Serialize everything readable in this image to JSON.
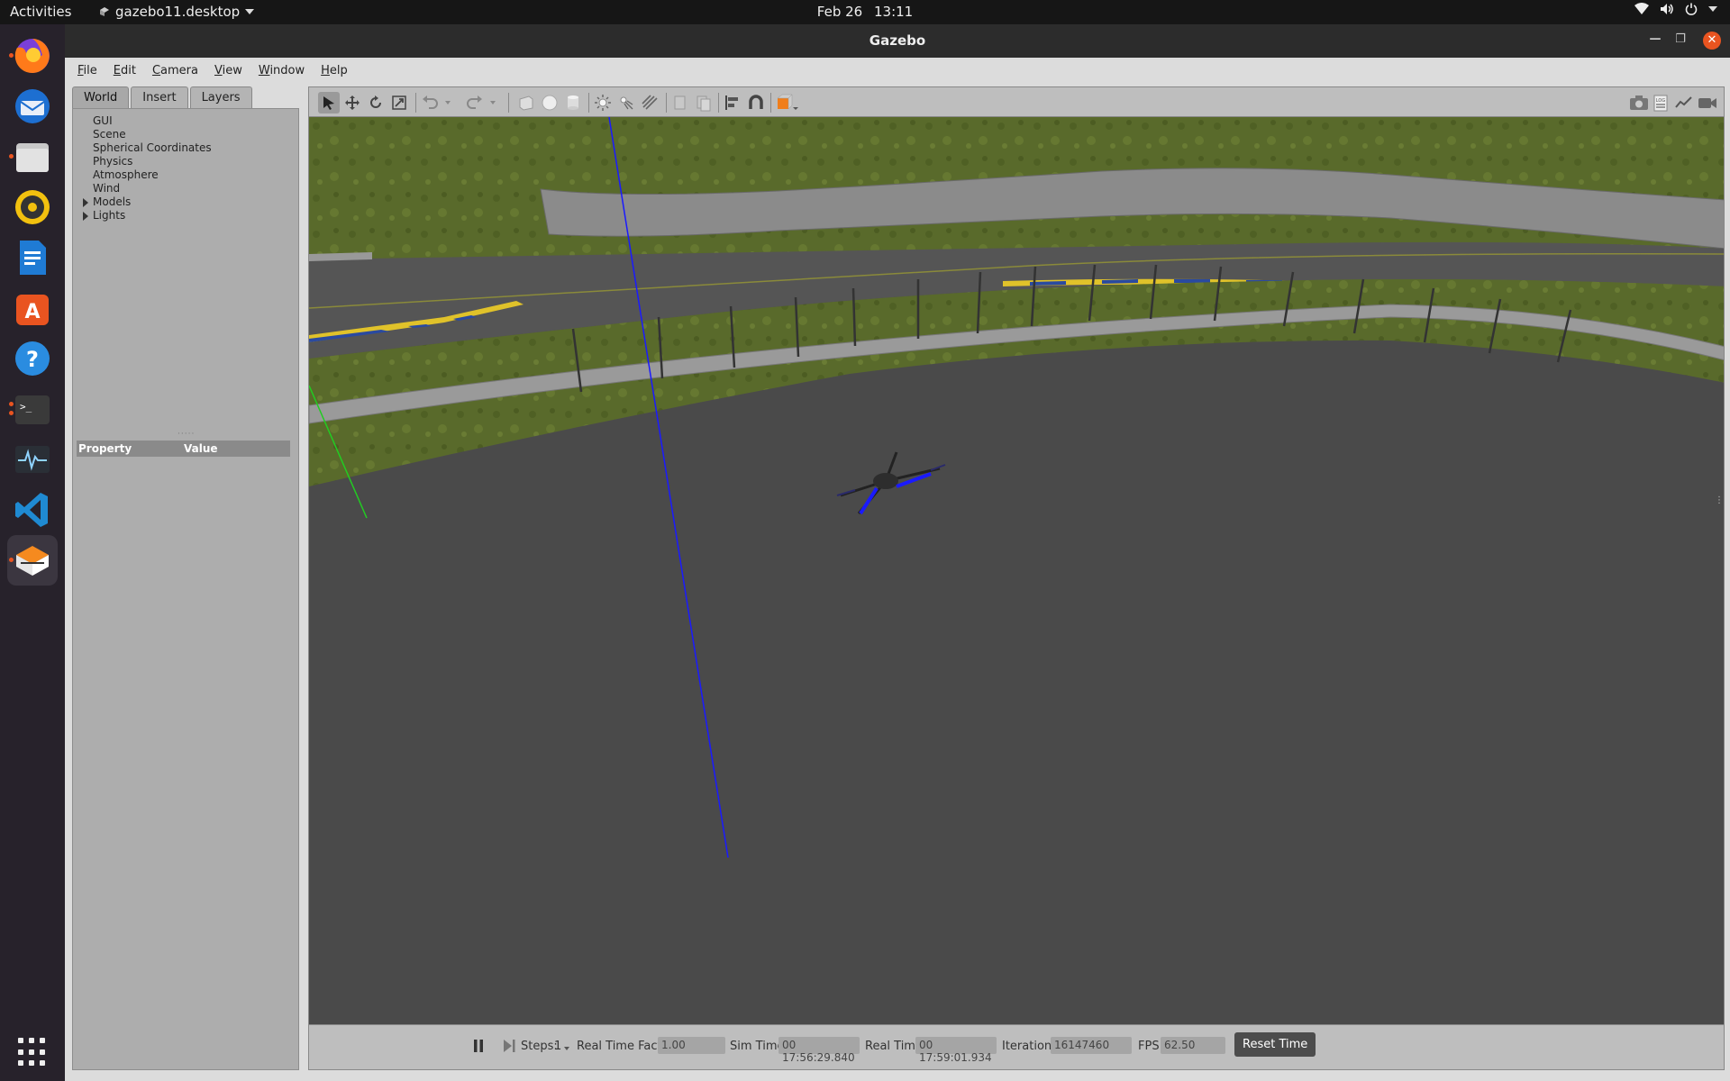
{
  "topbar": {
    "activities": "Activities",
    "app_menu": "gazebo11.desktop",
    "date": "Feb 26",
    "time": "13:11",
    "tray_icons": [
      "wifi-icon",
      "volume-icon",
      "power-icon"
    ]
  },
  "dock": {
    "apps": [
      "firefox",
      "thunderbird",
      "files",
      "rhythmbox",
      "libreoffice-writer",
      "app-center",
      "help",
      "terminal",
      "system-monitor",
      "vscode",
      "gazebo"
    ],
    "grid_icon": "show-applications-icon"
  },
  "window": {
    "title": "Gazebo",
    "menu": [
      "File",
      "Edit",
      "Camera",
      "View",
      "Window",
      "Help"
    ]
  },
  "left_panel": {
    "tabs": [
      "World",
      "Insert",
      "Layers"
    ],
    "active_tab": "World",
    "tree": [
      {
        "label": "GUI",
        "expandable": false
      },
      {
        "label": "Scene",
        "expandable": false
      },
      {
        "label": "Spherical Coordinates",
        "expandable": false
      },
      {
        "label": "Physics",
        "expandable": false
      },
      {
        "label": "Atmosphere",
        "expandable": false
      },
      {
        "label": "Wind",
        "expandable": false
      },
      {
        "label": "Models",
        "expandable": true
      },
      {
        "label": "Lights",
        "expandable": true
      }
    ],
    "property_header": "Property",
    "value_header": "Value"
  },
  "toolbar": {
    "left_tools": [
      "select-icon",
      "translate-icon",
      "rotate-icon",
      "scale-icon",
      "undo-icon",
      "redo-icon",
      "box-icon",
      "sphere-icon",
      "cylinder-icon",
      "point-light-icon",
      "spot-light-icon",
      "directional-light-icon",
      "copy-icon",
      "paste-icon",
      "align-icon",
      "snap-icon",
      "view-angle-icon"
    ],
    "right_tools": [
      "screenshot-icon",
      "log-icon",
      "plot-icon",
      "record-icon"
    ]
  },
  "bottom": {
    "steps_label": "Steps:",
    "steps_value": "1",
    "rtf_label": "Real Time Factor:",
    "rtf_value": "1.00",
    "sim_time_label": "Sim Time:",
    "sim_time_value": "00 17:56:29.840",
    "real_time_label": "Real Time:",
    "real_time_value": "00 17:59:01.934",
    "iterations_label": "Iterations:",
    "iterations_value": "16147460",
    "fps_label": "FPS:",
    "fps_value": "62.50",
    "reset_label": "Reset Time"
  },
  "colors": {
    "grass": "#5a6a2a",
    "asphalt": "#4b4b4b",
    "x_axis": "#1a1aff",
    "y_axis": "#22cc22",
    "accent": "#e95420"
  }
}
